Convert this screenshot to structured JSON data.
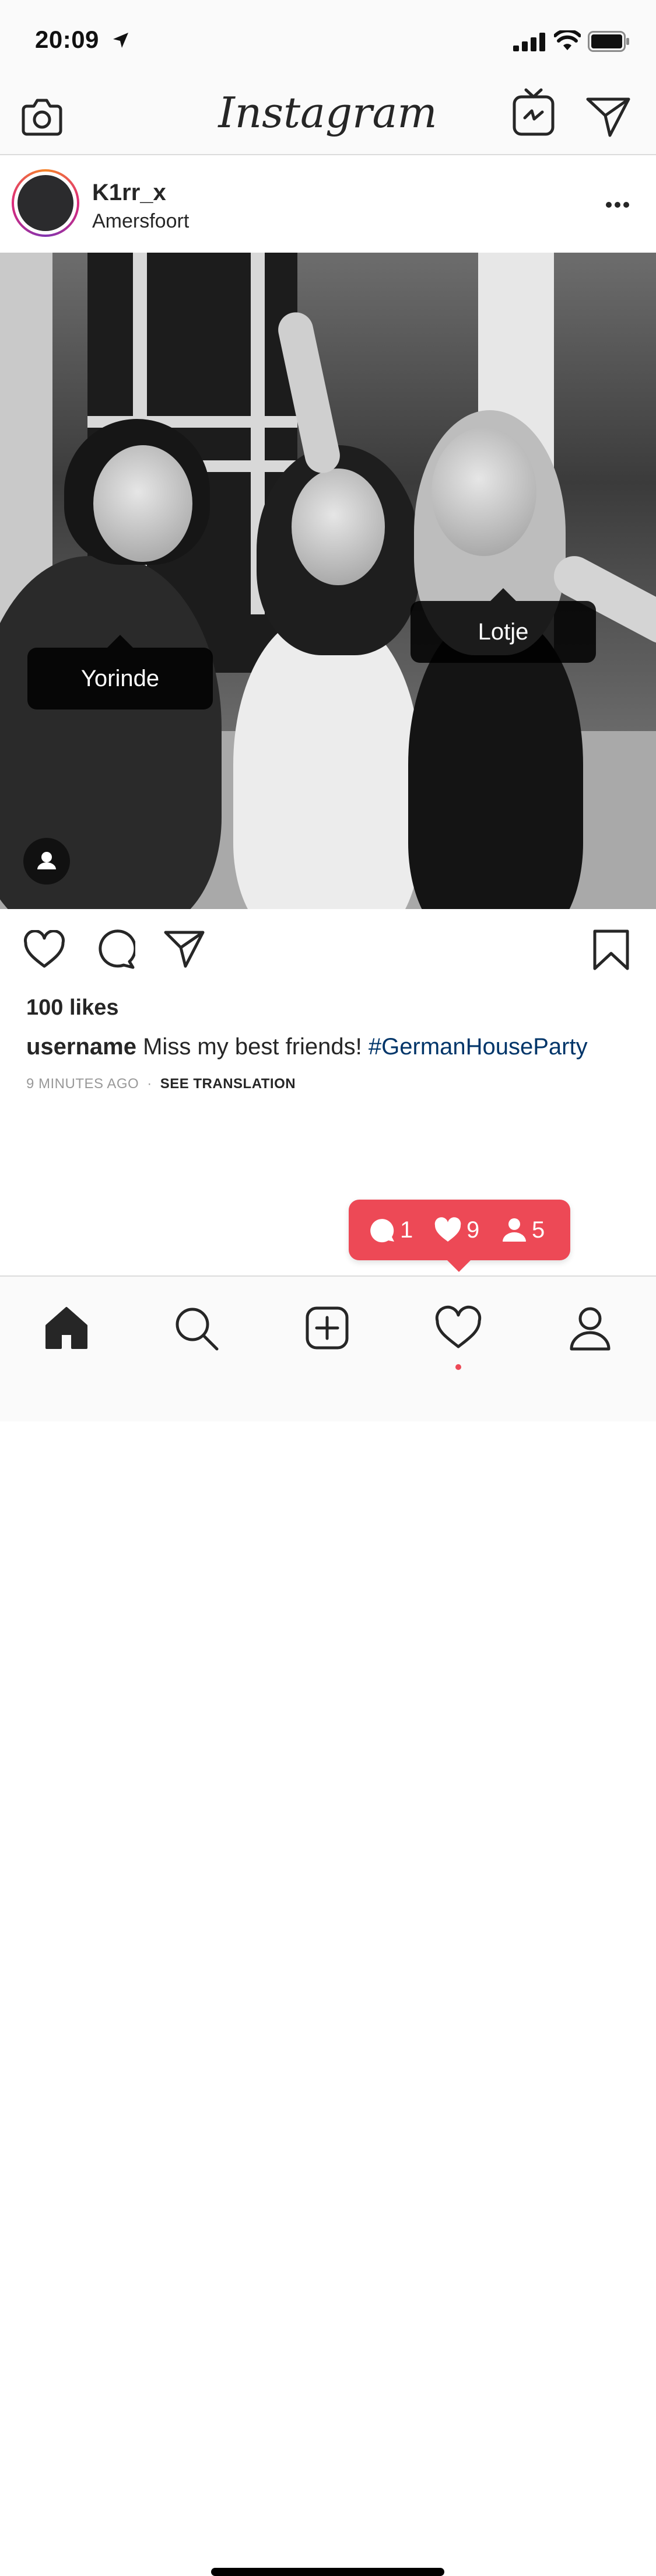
{
  "status_bar": {
    "time": "20:09"
  },
  "header": {
    "app_title": "Instagram"
  },
  "post": {
    "username": "K1rr_x",
    "location": "Amersfoort",
    "tags": [
      {
        "label": "Lotje"
      },
      {
        "label": "Yorinde"
      }
    ],
    "likes": "100 likes",
    "caption": {
      "username": "username",
      "text": "Miss my best friends!",
      "hashtag": "#GermanHouseParty"
    },
    "time_ago": "9 MINUTES AGO",
    "separator": "·",
    "see_translation": "SEE TRANSLATION"
  },
  "notification": {
    "comments": "1",
    "likes": "9",
    "follows": "5",
    "color": "#ed4956"
  },
  "colors": {
    "hashtag": "#003569",
    "accent": "#ed4956"
  },
  "tab_bar": {
    "tabs": [
      "home-icon",
      "search-icon",
      "new-post-icon",
      "activity-heart-icon",
      "profile-icon"
    ]
  }
}
